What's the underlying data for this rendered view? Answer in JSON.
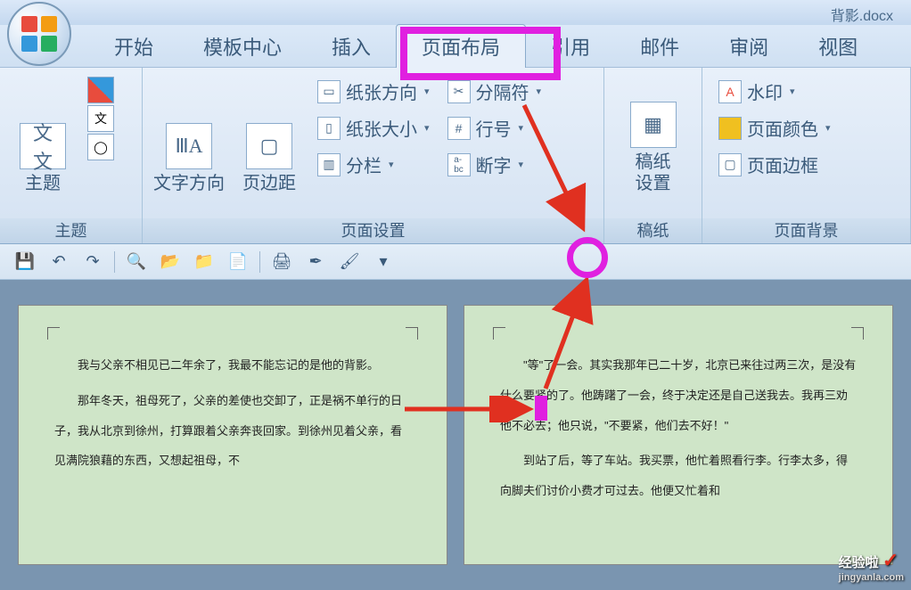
{
  "title": "背影.docx ",
  "tabs": {
    "start": "开始",
    "template": "模板中心",
    "insert": "插入",
    "layout": "页面布局",
    "reference": "引用",
    "mail": "邮件",
    "review": "审阅",
    "view": "视图"
  },
  "ribbon": {
    "theme": {
      "title": "主题",
      "big": "主题"
    },
    "pageSetup": {
      "title": "页面设置",
      "textDirection": "文字方向",
      "margins": "页边距",
      "orientation": "纸张方向",
      "size": "纸张大小",
      "columns": "分栏",
      "breaks": "分隔符",
      "lineNumbers": "行号",
      "hyphenation": "断字"
    },
    "paper": {
      "title": "稿纸",
      "setting": "稿纸\n设置"
    },
    "background": {
      "title": "页面背景",
      "watermark": "水印",
      "pageColor": "页面颜色",
      "pageBorder": "页面边框"
    }
  },
  "doc": {
    "page1": {
      "p1": "我与父亲不相见已二年余了，我最不能忘记的是他的背影。",
      "p2": "那年冬天，祖母死了，父亲的差使也交卸了，正是祸不单行的日子，我从北京到徐州，打算跟着父亲奔丧回家。到徐州见着父亲，看见满院狼藉的东西，又想起祖母，不"
    },
    "page2": {
      "p1": "\"等\"了一会。其实我那年已二十岁，北京已来往过两三次，是没有什么要紧的了。他踌躇了一会，终于决定还是自己送我去。我再三劝他不必去；他只说，\"不要紧，他们去不好！\"",
      "p2": "到站了后，等了车站。我买票，他忙着照看行李。行李太多，得向脚夫们讨价小费才可过去。他便又忙着和"
    }
  },
  "watermark": {
    "name": "经验啦",
    "domain": "jingyanla.com"
  }
}
